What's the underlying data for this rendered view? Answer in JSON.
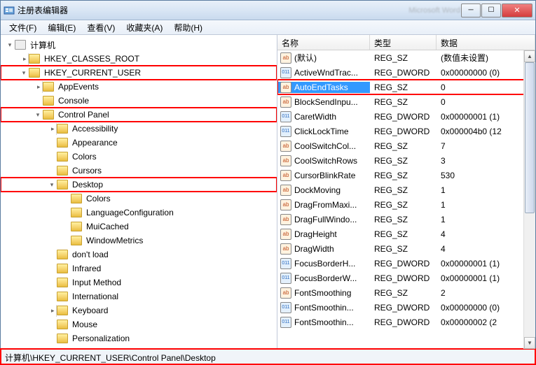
{
  "window": {
    "title": "注册表编辑器",
    "blur_title": "Microsoft Word"
  },
  "menu": [
    "文件(F)",
    "编辑(E)",
    "查看(V)",
    "收藏夹(A)",
    "帮助(H)"
  ],
  "tree": [
    {
      "depth": 0,
      "arrow": "exp",
      "icon": "comp",
      "label": "计算机",
      "hl": false
    },
    {
      "depth": 1,
      "arrow": "col",
      "icon": "folder",
      "label": "HKEY_CLASSES_ROOT",
      "hl": false
    },
    {
      "depth": 1,
      "arrow": "exp",
      "icon": "folder",
      "label": "HKEY_CURRENT_USER",
      "hl": true
    },
    {
      "depth": 2,
      "arrow": "col",
      "icon": "folder",
      "label": "AppEvents",
      "hl": false
    },
    {
      "depth": 2,
      "arrow": "none",
      "icon": "folder",
      "label": "Console",
      "hl": false
    },
    {
      "depth": 2,
      "arrow": "exp",
      "icon": "folder",
      "label": "Control Panel",
      "hl": true
    },
    {
      "depth": 3,
      "arrow": "col",
      "icon": "folder",
      "label": "Accessibility",
      "hl": false
    },
    {
      "depth": 3,
      "arrow": "none",
      "icon": "folder",
      "label": "Appearance",
      "hl": false
    },
    {
      "depth": 3,
      "arrow": "none",
      "icon": "folder",
      "label": "Colors",
      "hl": false
    },
    {
      "depth": 3,
      "arrow": "none",
      "icon": "folder",
      "label": "Cursors",
      "hl": false
    },
    {
      "depth": 3,
      "arrow": "exp",
      "icon": "folder",
      "label": "Desktop",
      "hl": true
    },
    {
      "depth": 4,
      "arrow": "none",
      "icon": "folder",
      "label": "Colors",
      "hl": false
    },
    {
      "depth": 4,
      "arrow": "none",
      "icon": "folder",
      "label": "LanguageConfiguration",
      "hl": false
    },
    {
      "depth": 4,
      "arrow": "none",
      "icon": "folder",
      "label": "MuiCached",
      "hl": false
    },
    {
      "depth": 4,
      "arrow": "none",
      "icon": "folder",
      "label": "WindowMetrics",
      "hl": false
    },
    {
      "depth": 3,
      "arrow": "none",
      "icon": "folder",
      "label": "don't load",
      "hl": false
    },
    {
      "depth": 3,
      "arrow": "none",
      "icon": "folder",
      "label": "Infrared",
      "hl": false
    },
    {
      "depth": 3,
      "arrow": "none",
      "icon": "folder",
      "label": "Input Method",
      "hl": false
    },
    {
      "depth": 3,
      "arrow": "none",
      "icon": "folder",
      "label": "International",
      "hl": false
    },
    {
      "depth": 3,
      "arrow": "col",
      "icon": "folder",
      "label": "Keyboard",
      "hl": false
    },
    {
      "depth": 3,
      "arrow": "none",
      "icon": "folder",
      "label": "Mouse",
      "hl": false
    },
    {
      "depth": 3,
      "arrow": "none",
      "icon": "folder",
      "label": "Personalization",
      "hl": false
    }
  ],
  "list": {
    "headers": {
      "name": "名称",
      "type": "类型",
      "data": "数据"
    },
    "rows": [
      {
        "icon": "sz",
        "name": "(默认)",
        "type": "REG_SZ",
        "data": "(数值未设置)",
        "sel": false,
        "hl": false
      },
      {
        "icon": "dw",
        "name": "ActiveWndTrac...",
        "type": "REG_DWORD",
        "data": "0x00000000 (0)",
        "sel": false,
        "hl": false
      },
      {
        "icon": "sz",
        "name": "AutoEndTasks",
        "type": "REG_SZ",
        "data": "0",
        "sel": true,
        "hl": true
      },
      {
        "icon": "sz",
        "name": "BlockSendInpu...",
        "type": "REG_SZ",
        "data": "0",
        "sel": false,
        "hl": false
      },
      {
        "icon": "dw",
        "name": "CaretWidth",
        "type": "REG_DWORD",
        "data": "0x00000001 (1)",
        "sel": false,
        "hl": false
      },
      {
        "icon": "dw",
        "name": "ClickLockTime",
        "type": "REG_DWORD",
        "data": "0x000004b0 (12",
        "sel": false,
        "hl": false
      },
      {
        "icon": "sz",
        "name": "CoolSwitchCol...",
        "type": "REG_SZ",
        "data": "7",
        "sel": false,
        "hl": false
      },
      {
        "icon": "sz",
        "name": "CoolSwitchRows",
        "type": "REG_SZ",
        "data": "3",
        "sel": false,
        "hl": false
      },
      {
        "icon": "sz",
        "name": "CursorBlinkRate",
        "type": "REG_SZ",
        "data": "530",
        "sel": false,
        "hl": false
      },
      {
        "icon": "sz",
        "name": "DockMoving",
        "type": "REG_SZ",
        "data": "1",
        "sel": false,
        "hl": false
      },
      {
        "icon": "sz",
        "name": "DragFromMaxi...",
        "type": "REG_SZ",
        "data": "1",
        "sel": false,
        "hl": false
      },
      {
        "icon": "sz",
        "name": "DragFullWindo...",
        "type": "REG_SZ",
        "data": "1",
        "sel": false,
        "hl": false
      },
      {
        "icon": "sz",
        "name": "DragHeight",
        "type": "REG_SZ",
        "data": "4",
        "sel": false,
        "hl": false
      },
      {
        "icon": "sz",
        "name": "DragWidth",
        "type": "REG_SZ",
        "data": "4",
        "sel": false,
        "hl": false
      },
      {
        "icon": "dw",
        "name": "FocusBorderH...",
        "type": "REG_DWORD",
        "data": "0x00000001 (1)",
        "sel": false,
        "hl": false
      },
      {
        "icon": "dw",
        "name": "FocusBorderW...",
        "type": "REG_DWORD",
        "data": "0x00000001 (1)",
        "sel": false,
        "hl": false
      },
      {
        "icon": "sz",
        "name": "FontSmoothing",
        "type": "REG_SZ",
        "data": "2",
        "sel": false,
        "hl": false
      },
      {
        "icon": "dw",
        "name": "FontSmoothin...",
        "type": "REG_DWORD",
        "data": "0x00000000 (0)",
        "sel": false,
        "hl": false
      },
      {
        "icon": "dw",
        "name": "FontSmoothin...",
        "type": "REG_DWORD",
        "data": "0x00000002 (2",
        "sel": false,
        "hl": false
      }
    ]
  },
  "statusbar": "计算机\\HKEY_CURRENT_USER\\Control Panel\\Desktop"
}
